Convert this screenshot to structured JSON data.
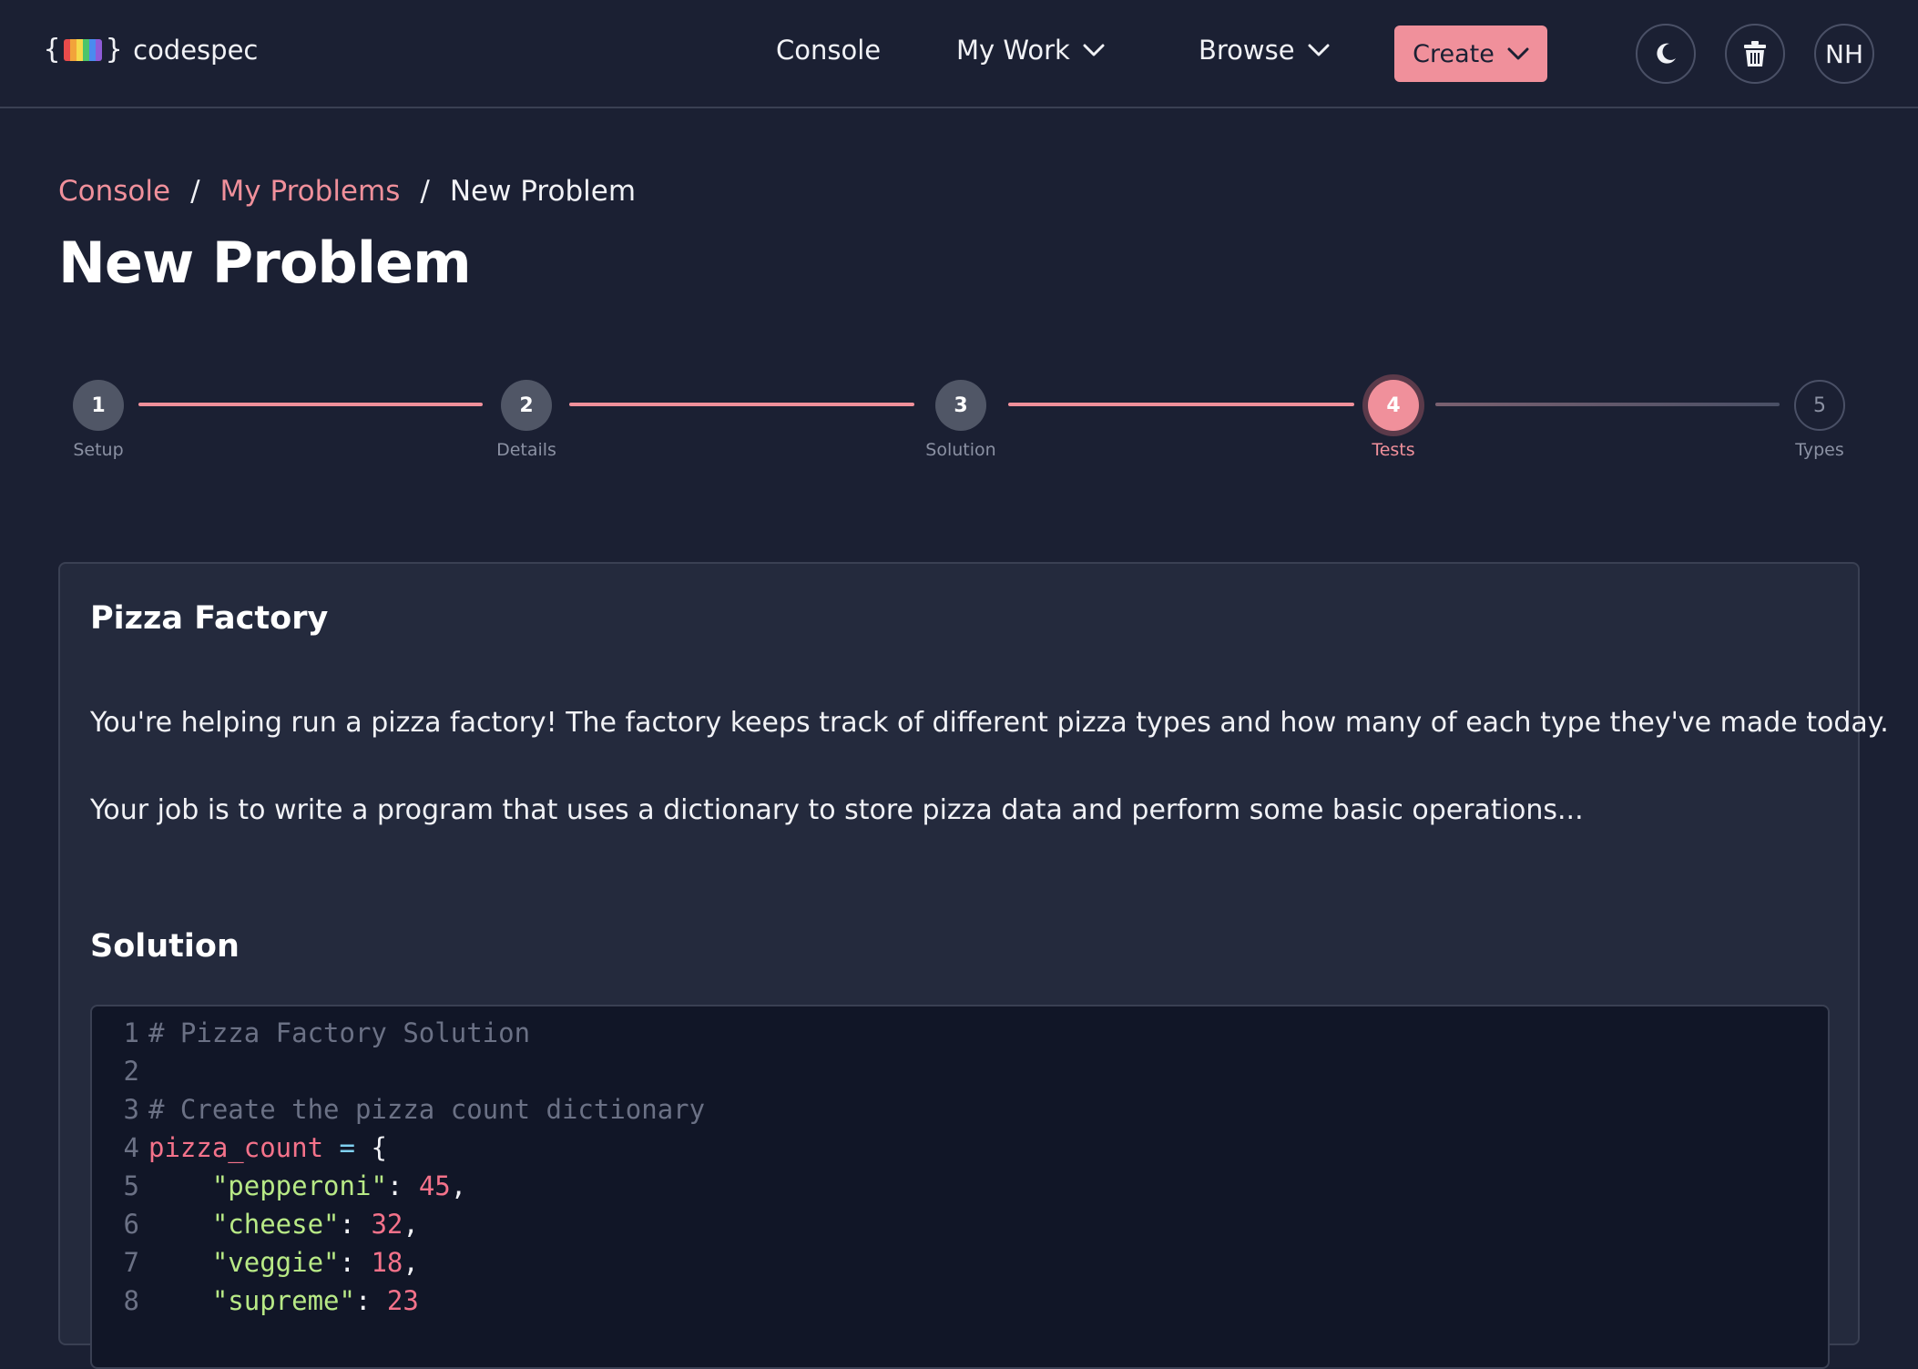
{
  "app": {
    "logo_brace_open": "{",
    "logo_brace_close": "}",
    "logo_text": "codespec",
    "logo_colors": [
      "#e94b4b",
      "#f2a33a",
      "#f5d94a",
      "#4bc46b",
      "#4a8bef",
      "#8e5bd8"
    ]
  },
  "nav": {
    "console": "Console",
    "my_work": "My Work",
    "browse": "Browse",
    "create": "Create",
    "theme_icon": "moon-icon",
    "trash_icon": "trash-icon",
    "avatar": "NH"
  },
  "breadcrumb": {
    "items": [
      "Console",
      "My Problems"
    ],
    "separator": "/",
    "current": "New Problem"
  },
  "page": {
    "title": "New Problem"
  },
  "stepper": {
    "current_step": 4,
    "steps": [
      {
        "number": "1",
        "label": "Setup",
        "state": "complete"
      },
      {
        "number": "2",
        "label": "Details",
        "state": "complete"
      },
      {
        "number": "3",
        "label": "Solution",
        "state": "complete"
      },
      {
        "number": "4",
        "label": "Tests",
        "state": "active"
      },
      {
        "number": "5",
        "label": "Types",
        "state": "pending"
      }
    ]
  },
  "problem": {
    "title": "Pizza Factory",
    "paragraphs": [
      "You're helping run a pizza factory! The factory keeps track of different pizza types and how many of each type they've made today.",
      "Your job is to write a program that uses a dictionary to store pizza data and perform some basic operations..."
    ]
  },
  "solution": {
    "heading": "Solution",
    "lines": [
      {
        "n": "1",
        "text": "# Pizza Factory Solution"
      },
      {
        "n": "2",
        "text": ""
      },
      {
        "n": "3",
        "text": "# Create the pizza count dictionary"
      },
      {
        "n": "4",
        "text": "pizza_count = {"
      },
      {
        "n": "5",
        "text": "    \"pepperoni\": 45,"
      },
      {
        "n": "6",
        "text": "    \"cheese\": 32,"
      },
      {
        "n": "7",
        "text": "    \"veggie\": 18,"
      },
      {
        "n": "8",
        "text": "    \"supreme\": 23"
      }
    ]
  },
  "colors": {
    "accent": "#f0909b",
    "background": "#1b2033",
    "card": "#242a3d",
    "editor": "#111627"
  }
}
